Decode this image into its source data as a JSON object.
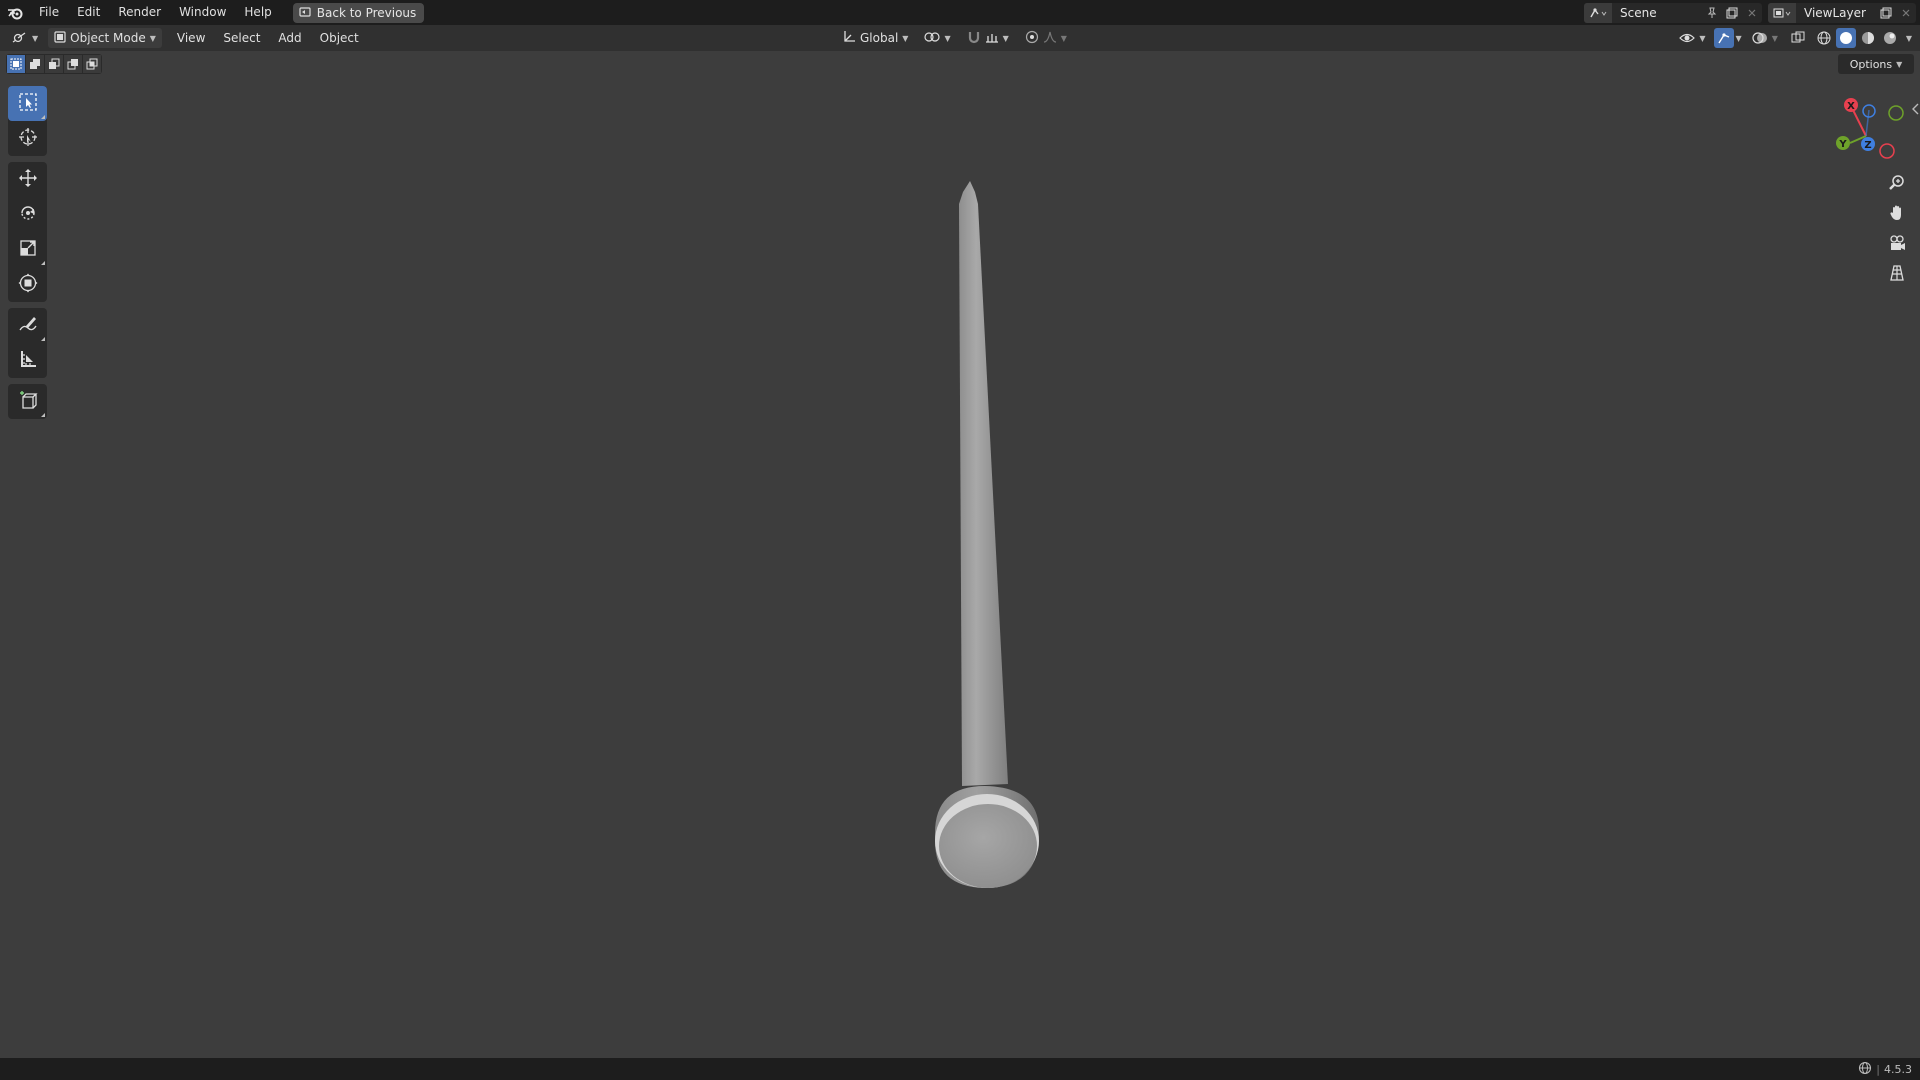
{
  "topbar": {
    "menu": [
      "File",
      "Edit",
      "Render",
      "Window",
      "Help"
    ],
    "back_button": "Back to Previous",
    "scene_name": "Scene",
    "view_layer_name": "ViewLayer"
  },
  "header": {
    "mode": "Object Mode",
    "menus": [
      "View",
      "Select",
      "Add",
      "Object"
    ],
    "transform_orientation": "Global"
  },
  "viewport": {
    "options_label": "Options",
    "gizmo_axes": [
      "X",
      "Y",
      "Z"
    ]
  },
  "toolbar": {
    "tools": [
      "select-box",
      "cursor",
      "move",
      "rotate",
      "scale",
      "transform",
      "annotate",
      "measure",
      "add-cube"
    ],
    "active_tool": "select-box"
  },
  "status": {
    "version": "4.5.3"
  },
  "colors": {
    "accent": "#4772b3",
    "x_axis": "#e8404f",
    "y_axis": "#6ea22a",
    "z_axis": "#3f7fe0"
  }
}
